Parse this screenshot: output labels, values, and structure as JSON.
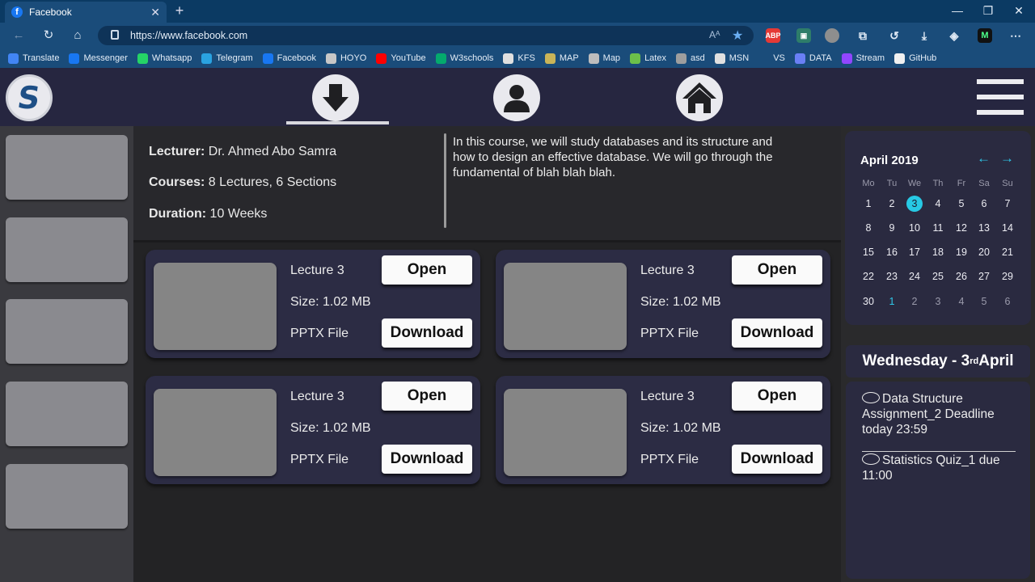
{
  "browser": {
    "tab_title": "Facebook",
    "tab_favicon": "facebook-icon",
    "url": "https://www.facebook.com",
    "reading_icon": "Aᴬ",
    "extensions": [
      {
        "name": "adblock-icon",
        "label": "ABP",
        "color": "#e53935"
      },
      {
        "name": "reader-icon",
        "label": "",
        "color": "#4caf50"
      },
      {
        "name": "globe-icon",
        "label": "",
        "color": "#9e9e9e"
      },
      {
        "name": "puzzle-icon",
        "label": "",
        "color": "#546e7a"
      }
    ]
  },
  "bookmarks": [
    {
      "label": "Translate",
      "icon": "translate-icon",
      "color": "#4285f4"
    },
    {
      "label": "Messenger",
      "icon": "facebook-icon",
      "color": "#1877f2"
    },
    {
      "label": "Whatsapp",
      "icon": "whatsapp-icon",
      "color": "#25d366"
    },
    {
      "label": "Telegram",
      "icon": "telegram-icon",
      "color": "#2aa3e1"
    },
    {
      "label": "Facebook",
      "icon": "facebook-icon",
      "color": "#1877f2"
    },
    {
      "label": "HOYO",
      "icon": "hoyo-icon",
      "color": "#c7c7c7"
    },
    {
      "label": "YouTube",
      "icon": "youtube-icon",
      "color": "#ff0000"
    },
    {
      "label": "W3schools",
      "icon": "w3schools-icon",
      "color": "#04aa6d"
    },
    {
      "label": "KFS",
      "icon": "page-icon",
      "color": "#e0e0e0"
    },
    {
      "label": "MAP",
      "icon": "map-icon",
      "color": "#c9b458"
    },
    {
      "label": "Map",
      "icon": "map-icon",
      "color": "#bdbdbd"
    },
    {
      "label": "Latex",
      "icon": "leaf-icon",
      "color": "#6cc04a"
    },
    {
      "label": "asd",
      "icon": "avatar-icon",
      "color": "#9e9e9e"
    },
    {
      "label": "MSN",
      "icon": "msn-icon",
      "color": "#e0e0e0"
    },
    {
      "label": "VS",
      "icon": "dollar-icon",
      "color": "#1a4c7a"
    },
    {
      "label": "DATA",
      "icon": "data-icon",
      "color": "#6a7ff5"
    },
    {
      "label": "Stream",
      "icon": "twitch-icon",
      "color": "#9146ff"
    },
    {
      "label": "GitHub",
      "icon": "github-icon",
      "color": "#f0f0f0"
    }
  ],
  "app": {
    "logo_text": "S",
    "nav": [
      {
        "name": "download-icon",
        "active": true
      },
      {
        "name": "profile-icon",
        "active": false
      },
      {
        "name": "home-icon",
        "active": false
      }
    ]
  },
  "course": {
    "lecturer_label": "Lecturer:",
    "lecturer_value": " Dr. Ahmed Abo Samra",
    "courses_label": "Courses:",
    "courses_value": " 8 Lectures, 6 Sections",
    "duration_label": "Duration:",
    "duration_value": " 10 Weeks",
    "description": "In this course, we will study databases and its structure and how to design an effective database. We will go through the fundamental of blah blah blah."
  },
  "lectures": [
    {
      "title": "Lecture 3",
      "size": "Size: 1.02 MB",
      "type": "PPTX File",
      "open": "Open",
      "download": "Download"
    },
    {
      "title": "Lecture 3",
      "size": "Size: 1.02 MB",
      "type": "PPTX File",
      "open": "Open",
      "download": "Download"
    },
    {
      "title": "Lecture 3",
      "size": "Size: 1.02 MB",
      "type": "PPTX File",
      "open": "Open",
      "download": "Download"
    },
    {
      "title": "Lecture 3",
      "size": "Size: 1.02 MB",
      "type": "PPTX File",
      "open": "Open",
      "download": "Download"
    }
  ],
  "calendar": {
    "title": "April 2019",
    "prev": "←",
    "next": "→",
    "weekdays": [
      "Mo",
      "Tu",
      "We",
      "Th",
      "Fr",
      "Sa",
      "Su"
    ],
    "weeks": [
      [
        "1",
        "2",
        "3",
        "4",
        "5",
        "6",
        "7"
      ],
      [
        "8",
        "9",
        "10",
        "11",
        "12",
        "13",
        "14"
      ],
      [
        "15",
        "16",
        "17",
        "18",
        "19",
        "20",
        "21"
      ],
      [
        "22",
        "23",
        "24",
        "25",
        "26",
        "27",
        "29"
      ],
      [
        "30",
        "1",
        "2",
        "3",
        "4",
        "5",
        "6"
      ]
    ],
    "today": "3",
    "accent": "#27c9e4"
  },
  "date_banner": {
    "weekday": "Wednesday",
    "dash": " - ",
    "day": "3",
    "suffix": "rd",
    "month": " April"
  },
  "notifications": [
    {
      "text": "Data Structure Assignment_2 Deadline today 23:59"
    },
    {
      "text": "Statistics Quiz_1 due 11:00"
    }
  ]
}
